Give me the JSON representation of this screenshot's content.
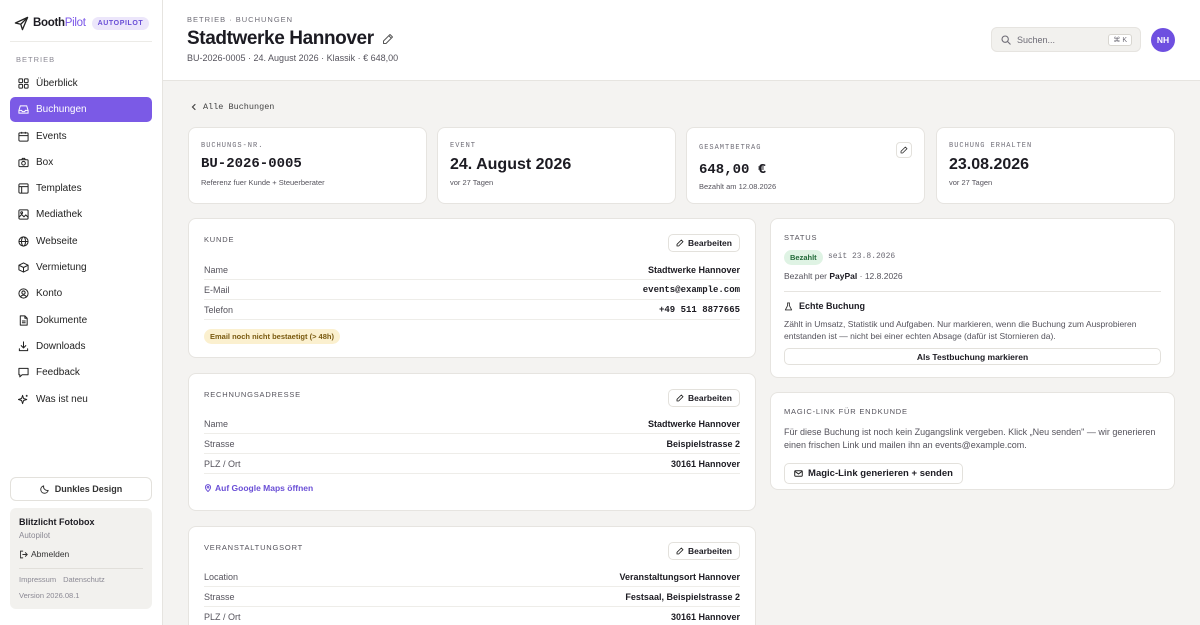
{
  "brand": {
    "name_bold": "Booth",
    "name_light": "Pilot",
    "badge": "AUTOPILOT"
  },
  "sidebar": {
    "section": "BETRIEB",
    "items": [
      {
        "label": "Überblick",
        "icon": "grid-icon"
      },
      {
        "label": "Buchungen",
        "icon": "inbox-icon",
        "active": true
      },
      {
        "label": "Events",
        "icon": "calendar-icon"
      },
      {
        "label": "Box",
        "icon": "camera-icon"
      },
      {
        "label": "Templates",
        "icon": "template-icon"
      },
      {
        "label": "Mediathek",
        "icon": "image-icon"
      },
      {
        "label": "Webseite",
        "icon": "globe-icon"
      },
      {
        "label": "Vermietung",
        "icon": "package-icon"
      },
      {
        "label": "Konto",
        "icon": "user-icon"
      },
      {
        "label": "Dokumente",
        "icon": "document-icon"
      },
      {
        "label": "Downloads",
        "icon": "download-icon"
      },
      {
        "label": "Feedback",
        "icon": "chat-icon"
      },
      {
        "label": "Was ist neu",
        "icon": "sparkle-icon"
      }
    ],
    "dark_mode_label": "Dunkles Design",
    "account": {
      "name": "Blitzlicht Fotobox",
      "plan": "Autopilot",
      "logout": "Abmelden",
      "imprint": "Impressum",
      "privacy": "Datenschutz",
      "version": "Version 2026.08.1"
    }
  },
  "header": {
    "breadcrumb": "BETRIEB · BUCHUNGEN",
    "title": "Stadtwerke Hannover",
    "subline": "BU-2026-0005 · 24. August 2026 · Klassik · € 648,00",
    "search_placeholder": "Suchen...",
    "search_shortcut": "⌘ K",
    "avatar_initials": "NH"
  },
  "back_link": "Alle Buchungen",
  "stats": [
    {
      "label": "BUCHUNGS-NR.",
      "value": "BU-2026-0005",
      "sub": "Referenz fuer Kunde + Steuerberater"
    },
    {
      "label": "EVENT",
      "value": "24. August 2026",
      "sub": "vor 27 Tagen"
    },
    {
      "label": "GESAMTBETRAG",
      "value": "648,00 €",
      "sub": "Bezahlt am 12.08.2026"
    },
    {
      "label": "BUCHUNG ERHALTEN",
      "value": "23.08.2026",
      "sub": "vor 27 Tagen"
    }
  ],
  "edit_label": "Bearbeiten",
  "customer": {
    "label": "KUNDE",
    "rows": [
      {
        "k": "Name",
        "v": "Stadtwerke Hannover"
      },
      {
        "k": "E-Mail",
        "v": "events@example.com"
      },
      {
        "k": "Telefon",
        "v": "+49 511 8877665"
      }
    ],
    "warning": "Email noch nicht bestaetigt (> 48h)"
  },
  "billing": {
    "label": "RECHNUNGSADRESSE",
    "rows": [
      {
        "k": "Name",
        "v": "Stadtwerke Hannover"
      },
      {
        "k": "Strasse",
        "v": "Beispielstrasse 2"
      },
      {
        "k": "PLZ / Ort",
        "v": "30161 Hannover"
      }
    ],
    "maps_link": "Auf Google Maps öffnen"
  },
  "venue": {
    "label": "VERANSTALTUNGSORT",
    "rows": [
      {
        "k": "Location",
        "v": "Veranstaltungsort Hannover"
      },
      {
        "k": "Strasse",
        "v": "Festsaal, Beispielstrasse 2"
      },
      {
        "k": "PLZ / Ort",
        "v": "30161 Hannover"
      }
    ]
  },
  "status": {
    "label": "STATUS",
    "badge": "Bezahlt",
    "since": "seit 23.8.2026",
    "paid_prefix": "Bezahlt per ",
    "paid_method": "PayPal",
    "paid_suffix": " · 12.8.2026",
    "real_title": "Echte Buchung",
    "real_desc": "Zählt in Umsatz, Statistik und Aufgaben. Nur markieren, wenn die Buchung zum Ausprobieren entstanden ist — nicht bei einer echten Absage (dafür ist Stornieren da).",
    "test_button": "Als Testbuchung markieren"
  },
  "magic_link": {
    "label": "MAGIC-LINK FÜR ENDKUNDE",
    "desc": "Für diese Buchung ist noch kein Zugangslink vergeben. Klick „Neu senden\" — wir generieren einen frischen Link und mailen ihn an events@example.com.",
    "button": "Magic-Link generieren + senden"
  },
  "colors": {
    "accent": "#7b5ae6",
    "paid": "#dff3e4",
    "warn": "#fbf0cf"
  }
}
